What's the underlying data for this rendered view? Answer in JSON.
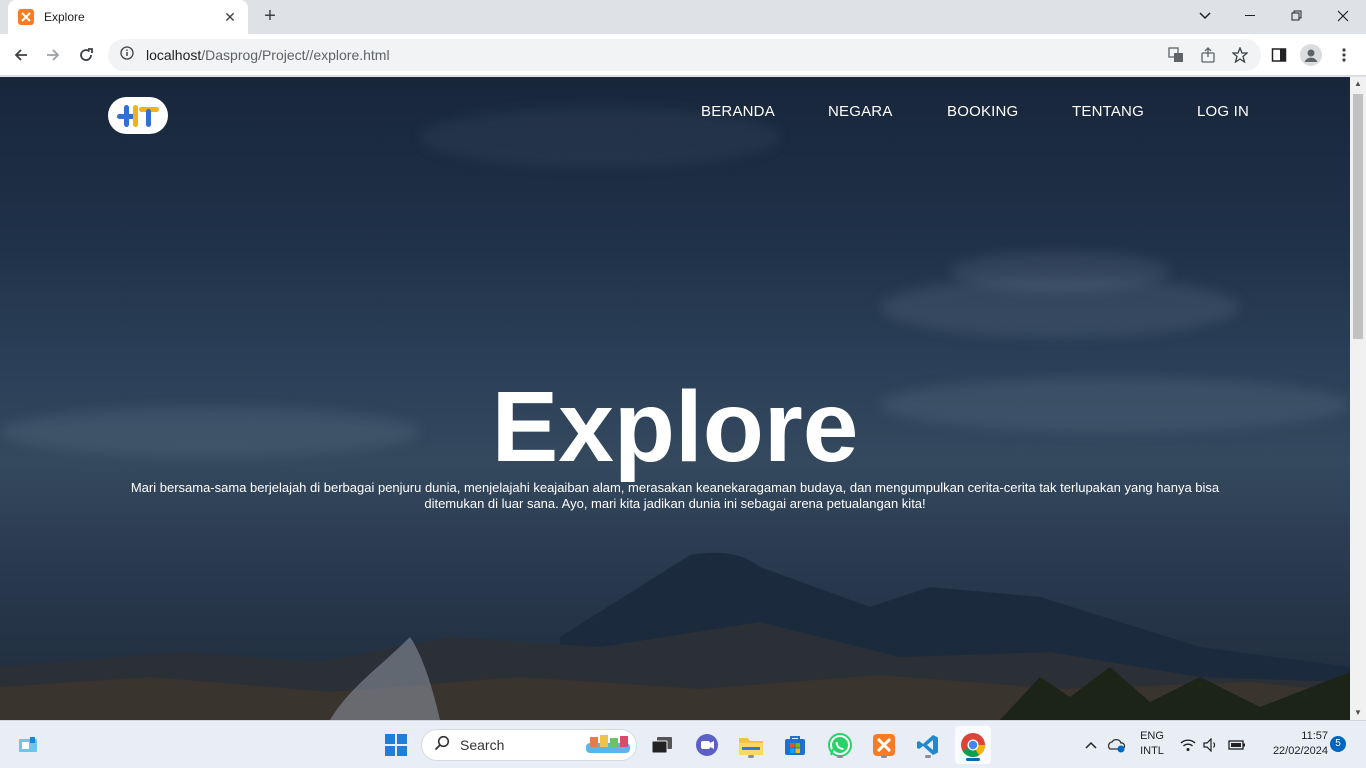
{
  "browser": {
    "tab_title": "Explore",
    "url_host": "localhost",
    "url_path": "/Dasprog/Project//explore.html"
  },
  "site": {
    "nav": [
      "BERANDA",
      "NEGARA",
      "BOOKING",
      "TENTANG",
      "LOG IN"
    ],
    "hero_title": "Explore",
    "hero_description": "Mari bersama-sama berjelajah di berbagai penjuru dunia, menjelajahi keajaiban alam, merasakan keanekaragaman budaya, dan mengumpulkan cerita-cerita tak terlupakan yang hanya bisa ditemukan di luar sana. Ayo, mari kita jadikan dunia ini sebagai arena petualangan kita!"
  },
  "taskbar": {
    "search_label": "Search",
    "lang_line1": "ENG",
    "lang_line2": "INTL",
    "time": "11:57",
    "date": "22/02/2024",
    "notification_count": "5"
  },
  "colors": {
    "accent": "#0067c0",
    "xampp": "#fb7a24",
    "logo_blue": "#2f6fd6",
    "logo_yellow": "#f2b01e"
  }
}
